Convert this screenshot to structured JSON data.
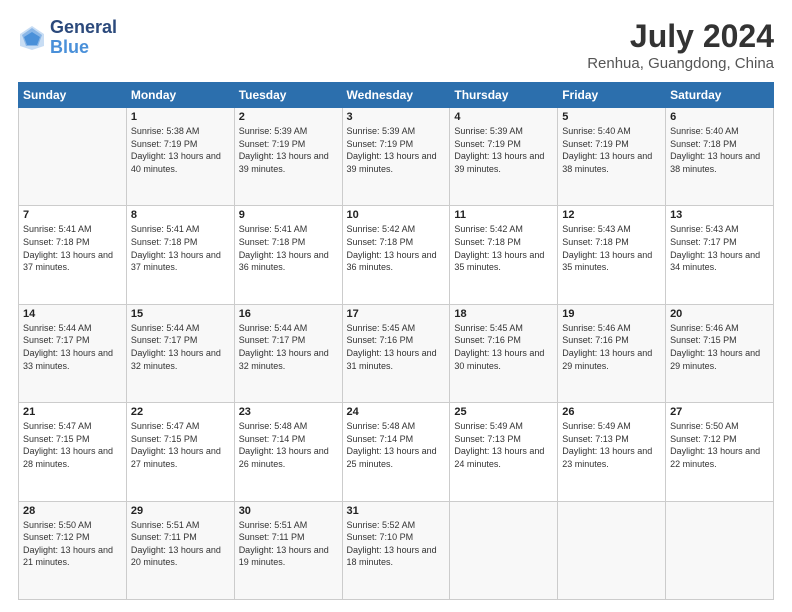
{
  "header": {
    "logo_line1": "General",
    "logo_line2": "Blue",
    "month_year": "July 2024",
    "location": "Renhua, Guangdong, China"
  },
  "weekdays": [
    "Sunday",
    "Monday",
    "Tuesday",
    "Wednesday",
    "Thursday",
    "Friday",
    "Saturday"
  ],
  "weeks": [
    [
      {
        "day": "",
        "sunrise": "",
        "sunset": "",
        "daylight": ""
      },
      {
        "day": "1",
        "sunrise": "Sunrise: 5:38 AM",
        "sunset": "Sunset: 7:19 PM",
        "daylight": "Daylight: 13 hours and 40 minutes."
      },
      {
        "day": "2",
        "sunrise": "Sunrise: 5:39 AM",
        "sunset": "Sunset: 7:19 PM",
        "daylight": "Daylight: 13 hours and 39 minutes."
      },
      {
        "day": "3",
        "sunrise": "Sunrise: 5:39 AM",
        "sunset": "Sunset: 7:19 PM",
        "daylight": "Daylight: 13 hours and 39 minutes."
      },
      {
        "day": "4",
        "sunrise": "Sunrise: 5:39 AM",
        "sunset": "Sunset: 7:19 PM",
        "daylight": "Daylight: 13 hours and 39 minutes."
      },
      {
        "day": "5",
        "sunrise": "Sunrise: 5:40 AM",
        "sunset": "Sunset: 7:19 PM",
        "daylight": "Daylight: 13 hours and 38 minutes."
      },
      {
        "day": "6",
        "sunrise": "Sunrise: 5:40 AM",
        "sunset": "Sunset: 7:18 PM",
        "daylight": "Daylight: 13 hours and 38 minutes."
      }
    ],
    [
      {
        "day": "7",
        "sunrise": "Sunrise: 5:41 AM",
        "sunset": "Sunset: 7:18 PM",
        "daylight": "Daylight: 13 hours and 37 minutes."
      },
      {
        "day": "8",
        "sunrise": "Sunrise: 5:41 AM",
        "sunset": "Sunset: 7:18 PM",
        "daylight": "Daylight: 13 hours and 37 minutes."
      },
      {
        "day": "9",
        "sunrise": "Sunrise: 5:41 AM",
        "sunset": "Sunset: 7:18 PM",
        "daylight": "Daylight: 13 hours and 36 minutes."
      },
      {
        "day": "10",
        "sunrise": "Sunrise: 5:42 AM",
        "sunset": "Sunset: 7:18 PM",
        "daylight": "Daylight: 13 hours and 36 minutes."
      },
      {
        "day": "11",
        "sunrise": "Sunrise: 5:42 AM",
        "sunset": "Sunset: 7:18 PM",
        "daylight": "Daylight: 13 hours and 35 minutes."
      },
      {
        "day": "12",
        "sunrise": "Sunrise: 5:43 AM",
        "sunset": "Sunset: 7:18 PM",
        "daylight": "Daylight: 13 hours and 35 minutes."
      },
      {
        "day": "13",
        "sunrise": "Sunrise: 5:43 AM",
        "sunset": "Sunset: 7:17 PM",
        "daylight": "Daylight: 13 hours and 34 minutes."
      }
    ],
    [
      {
        "day": "14",
        "sunrise": "Sunrise: 5:44 AM",
        "sunset": "Sunset: 7:17 PM",
        "daylight": "Daylight: 13 hours and 33 minutes."
      },
      {
        "day": "15",
        "sunrise": "Sunrise: 5:44 AM",
        "sunset": "Sunset: 7:17 PM",
        "daylight": "Daylight: 13 hours and 32 minutes."
      },
      {
        "day": "16",
        "sunrise": "Sunrise: 5:44 AM",
        "sunset": "Sunset: 7:17 PM",
        "daylight": "Daylight: 13 hours and 32 minutes."
      },
      {
        "day": "17",
        "sunrise": "Sunrise: 5:45 AM",
        "sunset": "Sunset: 7:16 PM",
        "daylight": "Daylight: 13 hours and 31 minutes."
      },
      {
        "day": "18",
        "sunrise": "Sunrise: 5:45 AM",
        "sunset": "Sunset: 7:16 PM",
        "daylight": "Daylight: 13 hours and 30 minutes."
      },
      {
        "day": "19",
        "sunrise": "Sunrise: 5:46 AM",
        "sunset": "Sunset: 7:16 PM",
        "daylight": "Daylight: 13 hours and 29 minutes."
      },
      {
        "day": "20",
        "sunrise": "Sunrise: 5:46 AM",
        "sunset": "Sunset: 7:15 PM",
        "daylight": "Daylight: 13 hours and 29 minutes."
      }
    ],
    [
      {
        "day": "21",
        "sunrise": "Sunrise: 5:47 AM",
        "sunset": "Sunset: 7:15 PM",
        "daylight": "Daylight: 13 hours and 28 minutes."
      },
      {
        "day": "22",
        "sunrise": "Sunrise: 5:47 AM",
        "sunset": "Sunset: 7:15 PM",
        "daylight": "Daylight: 13 hours and 27 minutes."
      },
      {
        "day": "23",
        "sunrise": "Sunrise: 5:48 AM",
        "sunset": "Sunset: 7:14 PM",
        "daylight": "Daylight: 13 hours and 26 minutes."
      },
      {
        "day": "24",
        "sunrise": "Sunrise: 5:48 AM",
        "sunset": "Sunset: 7:14 PM",
        "daylight": "Daylight: 13 hours and 25 minutes."
      },
      {
        "day": "25",
        "sunrise": "Sunrise: 5:49 AM",
        "sunset": "Sunset: 7:13 PM",
        "daylight": "Daylight: 13 hours and 24 minutes."
      },
      {
        "day": "26",
        "sunrise": "Sunrise: 5:49 AM",
        "sunset": "Sunset: 7:13 PM",
        "daylight": "Daylight: 13 hours and 23 minutes."
      },
      {
        "day": "27",
        "sunrise": "Sunrise: 5:50 AM",
        "sunset": "Sunset: 7:12 PM",
        "daylight": "Daylight: 13 hours and 22 minutes."
      }
    ],
    [
      {
        "day": "28",
        "sunrise": "Sunrise: 5:50 AM",
        "sunset": "Sunset: 7:12 PM",
        "daylight": "Daylight: 13 hours and 21 minutes."
      },
      {
        "day": "29",
        "sunrise": "Sunrise: 5:51 AM",
        "sunset": "Sunset: 7:11 PM",
        "daylight": "Daylight: 13 hours and 20 minutes."
      },
      {
        "day": "30",
        "sunrise": "Sunrise: 5:51 AM",
        "sunset": "Sunset: 7:11 PM",
        "daylight": "Daylight: 13 hours and 19 minutes."
      },
      {
        "day": "31",
        "sunrise": "Sunrise: 5:52 AM",
        "sunset": "Sunset: 7:10 PM",
        "daylight": "Daylight: 13 hours and 18 minutes."
      },
      {
        "day": "",
        "sunrise": "",
        "sunset": "",
        "daylight": ""
      },
      {
        "day": "",
        "sunrise": "",
        "sunset": "",
        "daylight": ""
      },
      {
        "day": "",
        "sunrise": "",
        "sunset": "",
        "daylight": ""
      }
    ]
  ]
}
